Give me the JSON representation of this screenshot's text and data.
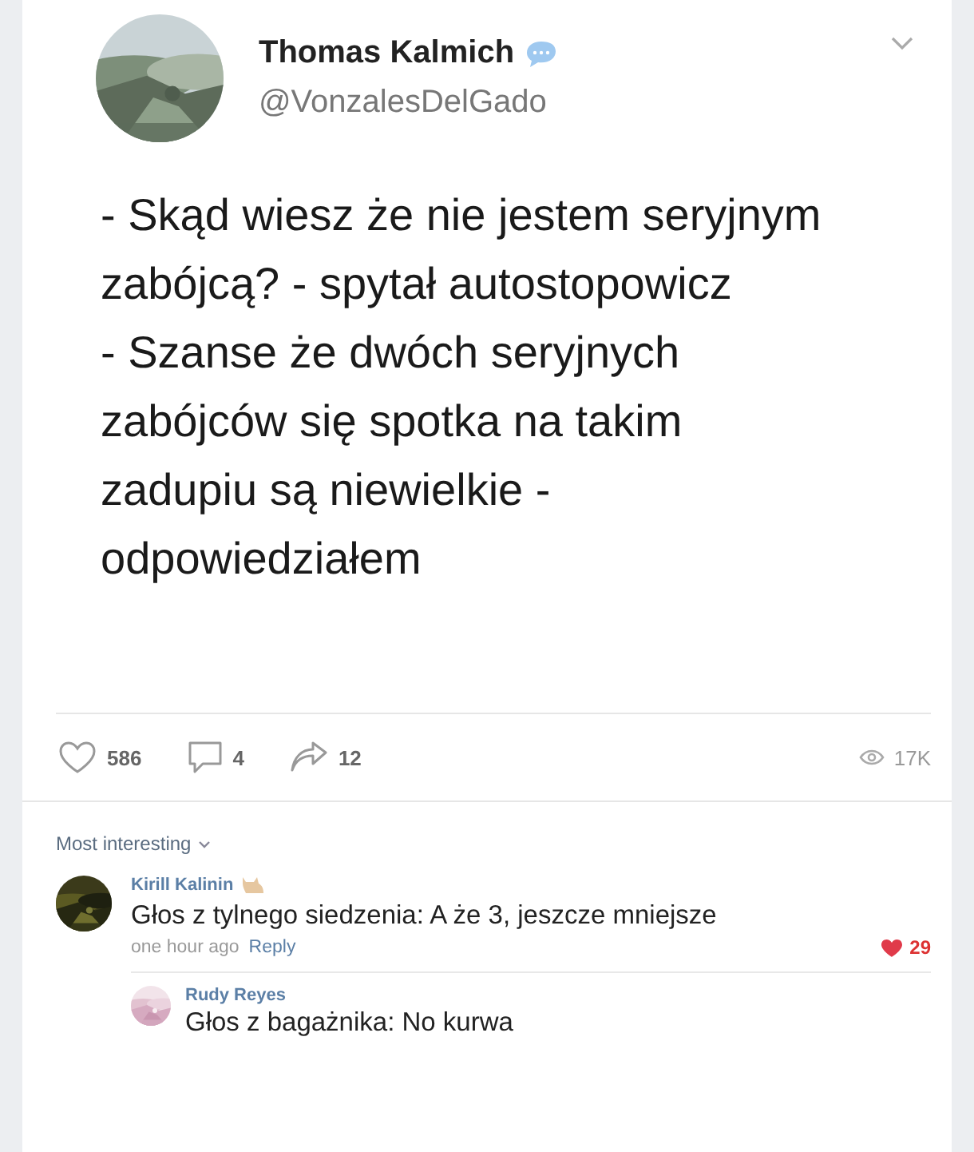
{
  "post": {
    "author": "Thomas Kalmich",
    "handle": "@VonzalesDelGado",
    "paragraphs": [
      "- Skąd wiesz że nie jestem seryjnym zabójcą? - spytał autostopowicz",
      "- Szanse że dwóch seryjnych zabójców się spotka na takim zadupiu są niewielkie - odpowiedziałem"
    ],
    "likes": "586",
    "comments": "4",
    "shares": "12",
    "views": "17K"
  },
  "comments_sort": "Most interesting",
  "comments": [
    {
      "author": "Kirill Kalinin",
      "text": "Głos z tylnego siedzenia: A że 3, jeszcze mniejsze",
      "time": "one hour ago",
      "reply": "Reply",
      "likes": "29",
      "replies": [
        {
          "author": "Rudy Reyes",
          "text": "Głos z bagażnika: No kurwa"
        }
      ]
    }
  ]
}
